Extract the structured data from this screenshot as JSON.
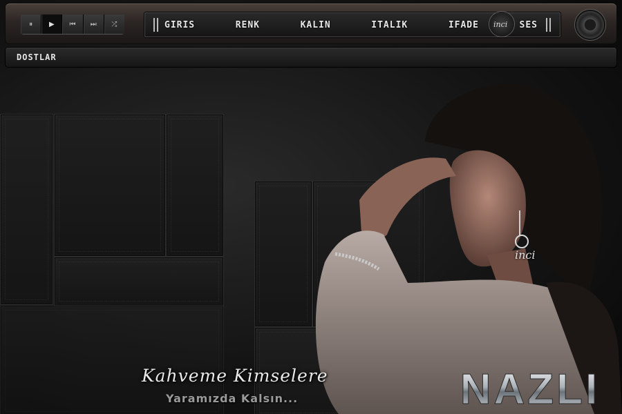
{
  "player": {
    "controls": [
      {
        "name": "pause",
        "glyph": "⏸"
      },
      {
        "name": "play",
        "glyph": "▶"
      },
      {
        "name": "previous",
        "glyph": "⏮"
      },
      {
        "name": "next",
        "glyph": "⏭"
      },
      {
        "name": "shuffle",
        "glyph": "⤮"
      }
    ],
    "active_control": "play"
  },
  "menu": {
    "items": [
      "GIRIS",
      "RENK",
      "KALIN",
      "ITALIK",
      "IFADE",
      "SES"
    ],
    "seal_text": "inci"
  },
  "friends": {
    "label": "DOSTLAR"
  },
  "artwork": {
    "watermark": "inci",
    "poem_line1": "Kahvemе Kimselere",
    "poem_line2": "Yaramızda Kalsın...",
    "logo_text": "NAZLI"
  },
  "colors": {
    "accent": "#4a3f3a",
    "text": "#e8e8e8"
  }
}
